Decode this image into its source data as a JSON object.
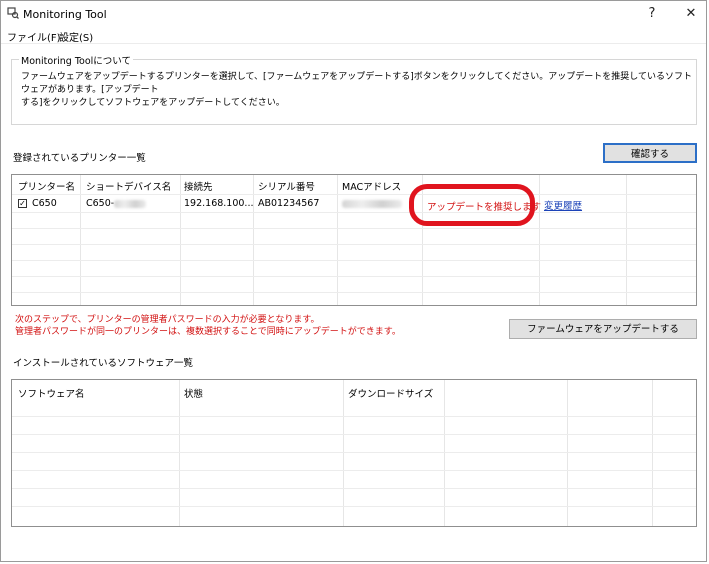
{
  "window": {
    "title": "Monitoring Tool",
    "help_label": "?",
    "close_label": "✕"
  },
  "menu": {
    "items": [
      "ファイル(F)",
      "設定(S)"
    ]
  },
  "about": {
    "legend": "Monitoring Toolについて",
    "text_line1": "ファームウェアをアップデートするプリンターを選択して、[ファームウェアをアップデートする]ボタンをクリックしてください。アップデートを推奨しているソフトウェアがあります。[アップデート",
    "text_line2": "する]をクリックしてソフトウェアをアップデートしてください。"
  },
  "printers": {
    "section_label": "登録されているプリンター一覧",
    "check_button": "確認する",
    "columns": [
      "プリンター名",
      "ショートデバイス名",
      "接続先",
      "シリアル番号",
      "MACアドレス"
    ],
    "rows": [
      {
        "name": "C650",
        "checked": true,
        "short_device_prefix": "C650-",
        "connection": "192.168.100...",
        "serial": "AB01234567",
        "status": "アップデートを推奨します",
        "history_link": "変更履歴"
      }
    ]
  },
  "notice": {
    "line1": "次のステップで、プリンターの管理者パスワードの入力が必要となります。",
    "line2": "管理者パスワードが同一のプリンターは、複数選択することで同時にアップデートができます。"
  },
  "update_button": "ファームウェアをアップデートする",
  "software": {
    "section_label": "インストールされているソフトウェア一覧",
    "columns": [
      "ソフトウェア名",
      "状態",
      "ダウンロードサイズ"
    ]
  },
  "colors": {
    "status_red": "#d21010",
    "link_blue": "#1c43b8",
    "highlight_red": "#e0141e",
    "focus_blue": "#2c6fc7"
  }
}
